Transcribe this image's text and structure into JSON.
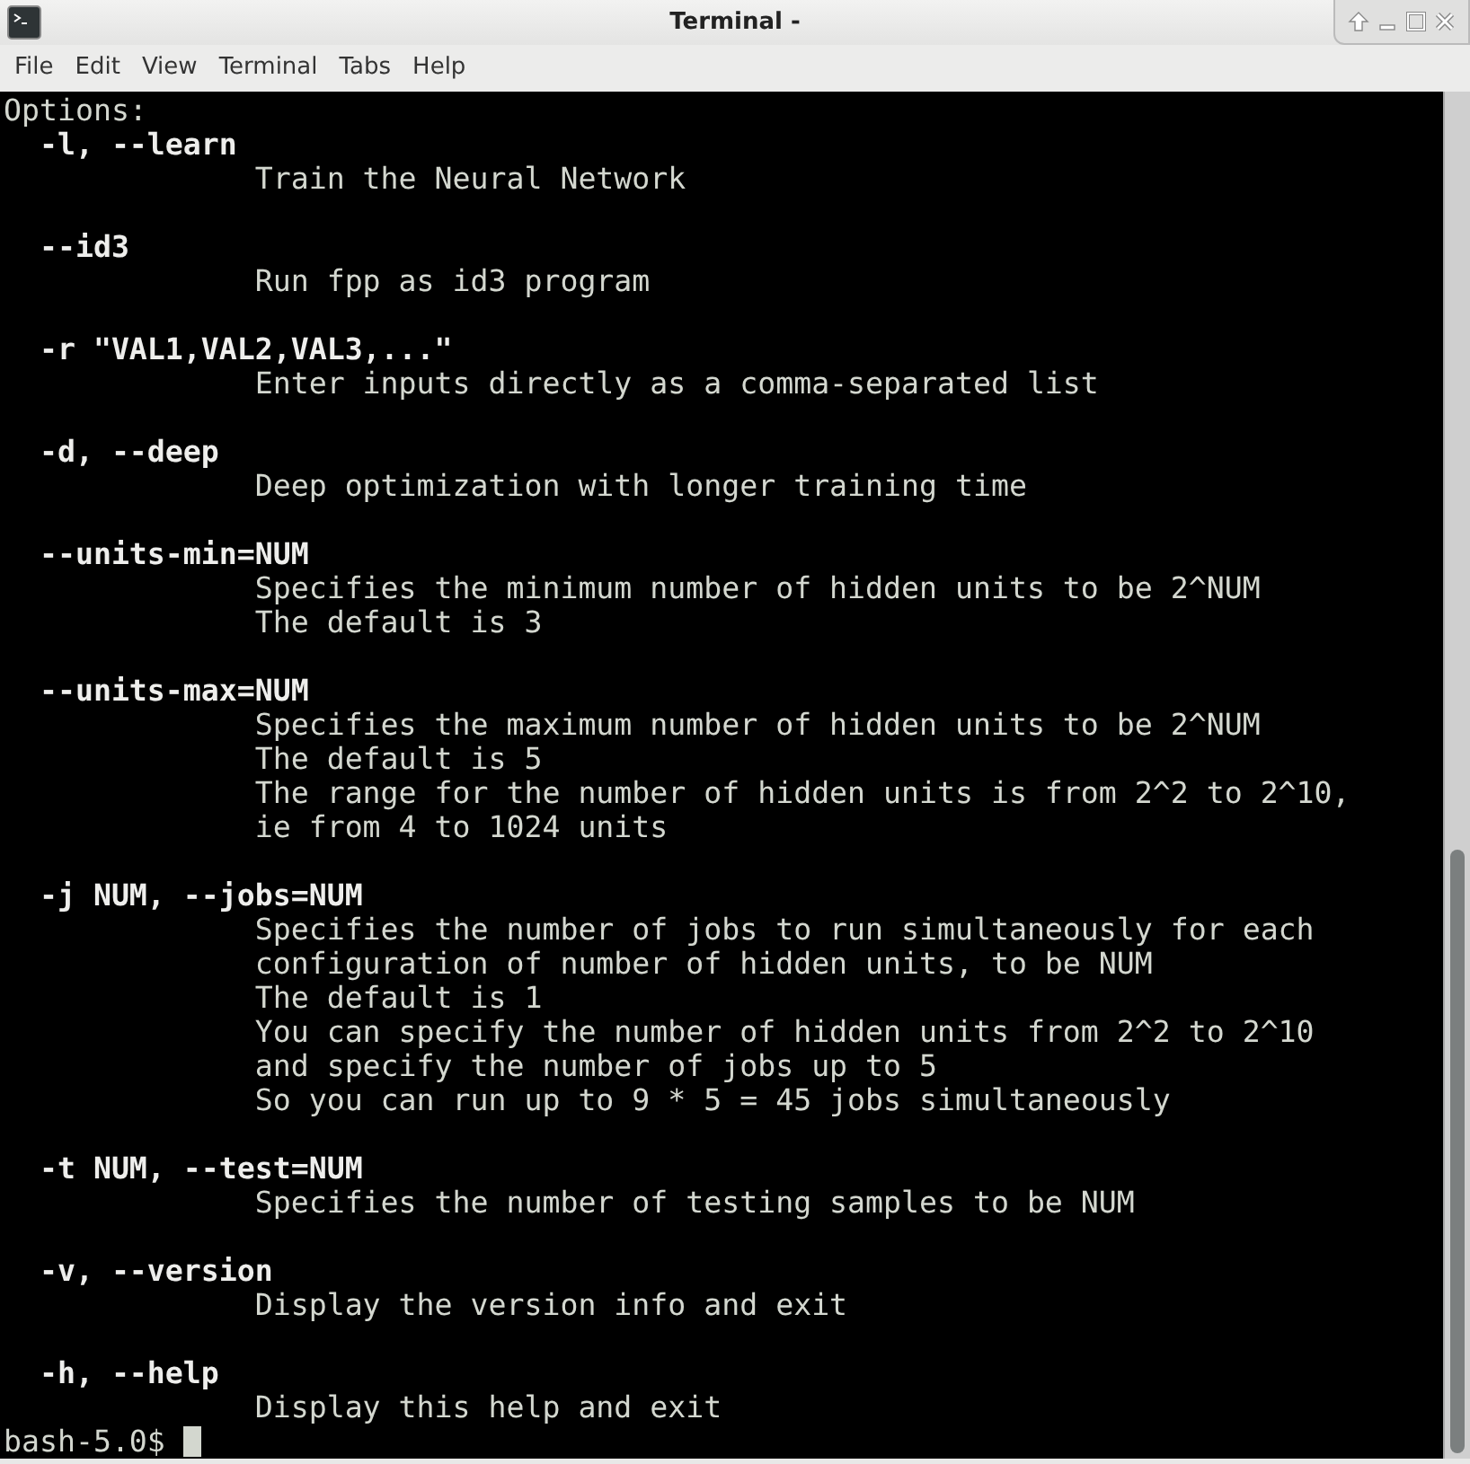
{
  "window": {
    "title": "Terminal -"
  },
  "menu": [
    "File",
    "Edit",
    "View",
    "Terminal",
    "Tabs",
    "Help"
  ],
  "terminal": {
    "heading": "Options:",
    "options": [
      {
        "flag": "  -l, --learn",
        "description": [
          "              Train the Neural Network"
        ]
      },
      {
        "flag": "  --id3",
        "description": [
          "              Run fpp as id3 program"
        ]
      },
      {
        "flag": "  -r \"VAL1,VAL2,VAL3,...\"",
        "description": [
          "              Enter inputs directly as a comma-separated list"
        ]
      },
      {
        "flag": "  -d, --deep",
        "description": [
          "              Deep optimization with longer training time"
        ]
      },
      {
        "flag": "  --units-min=NUM",
        "description": [
          "              Specifies the minimum number of hidden units to be 2^NUM",
          "              The default is 3"
        ]
      },
      {
        "flag": "  --units-max=NUM",
        "description": [
          "              Specifies the maximum number of hidden units to be 2^NUM",
          "              The default is 5",
          "              The range for the number of hidden units is from 2^2 to 2^10,",
          "              ie from 4 to 1024 units"
        ]
      },
      {
        "flag": "  -j NUM, --jobs=NUM",
        "description": [
          "              Specifies the number of jobs to run simultaneously for each",
          "              configuration of number of hidden units, to be NUM",
          "              The default is 1",
          "              You can specify the number of hidden units from 2^2 to 2^10",
          "              and specify the number of jobs up to 5",
          "              So you can run up to 9 * 5 = 45 jobs simultaneously"
        ]
      },
      {
        "flag": "  -t NUM, --test=NUM",
        "description": [
          "              Specifies the number of testing samples to be NUM"
        ]
      },
      {
        "flag": "  -v, --version",
        "description": [
          "              Display the version info and exit"
        ]
      },
      {
        "flag": "  -h, --help",
        "description": [
          "              Display this help and exit"
        ]
      }
    ],
    "prompt": "bash-5.0$ "
  }
}
